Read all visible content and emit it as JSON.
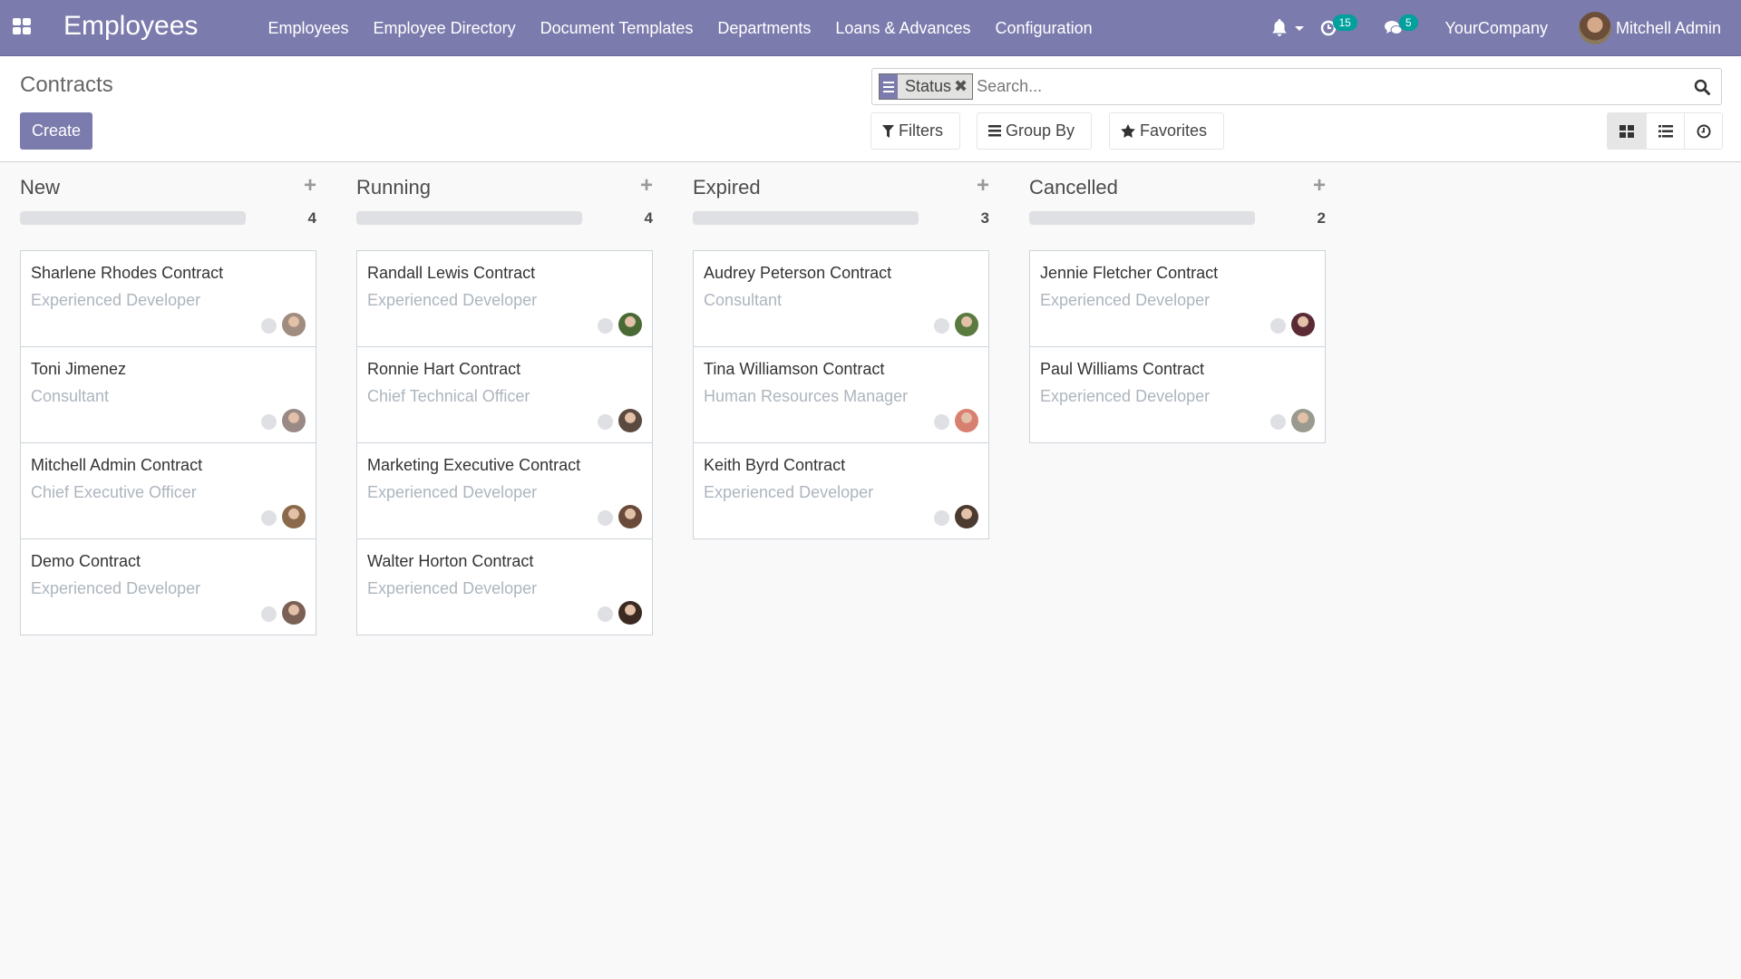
{
  "navbar": {
    "app_title": "Employees",
    "menu": [
      "Employees",
      "Employee Directory",
      "Document Templates",
      "Departments",
      "Loans & Advances",
      "Configuration"
    ],
    "activity_count": "15",
    "messages_count": "5",
    "company": "YourCompany",
    "user_name": "Mitchell Admin",
    "accent_color": "#7c7bad",
    "badge_color": "#00a09d"
  },
  "control_panel": {
    "breadcrumb": "Contracts",
    "create_label": "Create",
    "search": {
      "facet_label": "Status",
      "placeholder": "Search..."
    },
    "filters_label": "Filters",
    "groupby_label": "Group By",
    "favorites_label": "Favorites",
    "views": [
      "kanban-view",
      "list-view",
      "activity-view"
    ],
    "active_view": "kanban-view"
  },
  "kanban": {
    "columns": [
      {
        "title": "New",
        "count": "4",
        "cards": [
          {
            "title": "Sharlene Rhodes Contract",
            "subtitle": "Experienced Developer",
            "avatar": "#a08c80"
          },
          {
            "title": "Toni Jimenez",
            "subtitle": "Consultant",
            "avatar": "#9a8a86"
          },
          {
            "title": "Mitchell Admin Contract",
            "subtitle": "Chief Executive Officer",
            "avatar": "#8a6a4a"
          },
          {
            "title": "Demo Contract",
            "subtitle": "Experienced Developer",
            "avatar": "#7a6055"
          }
        ]
      },
      {
        "title": "Running",
        "count": "4",
        "cards": [
          {
            "title": "Randall Lewis Contract",
            "subtitle": "Experienced Developer",
            "avatar": "#4a6a35"
          },
          {
            "title": "Ronnie Hart Contract",
            "subtitle": "Chief Technical Officer",
            "avatar": "#5a4a40"
          },
          {
            "title": "Marketing Executive Contract",
            "subtitle": "Experienced Developer",
            "avatar": "#6a4a3a"
          },
          {
            "title": "Walter Horton Contract",
            "subtitle": "Experienced Developer",
            "avatar": "#3a2a22"
          }
        ]
      },
      {
        "title": "Expired",
        "count": "3",
        "cards": [
          {
            "title": "Audrey Peterson Contract",
            "subtitle": "Consultant",
            "avatar": "#5a7a40"
          },
          {
            "title": "Tina Williamson Contract",
            "subtitle": "Human Resources Manager",
            "avatar": "#d88070"
          },
          {
            "title": "Keith Byrd Contract",
            "subtitle": "Experienced Developer",
            "avatar": "#4a3a30"
          }
        ]
      },
      {
        "title": "Cancelled",
        "count": "2",
        "cards": [
          {
            "title": "Jennie Fletcher Contract",
            "subtitle": "Experienced Developer",
            "avatar": "#5a2a35"
          },
          {
            "title": "Paul Williams Contract",
            "subtitle": "Experienced Developer",
            "avatar": "#9a9a90"
          }
        ]
      }
    ]
  }
}
